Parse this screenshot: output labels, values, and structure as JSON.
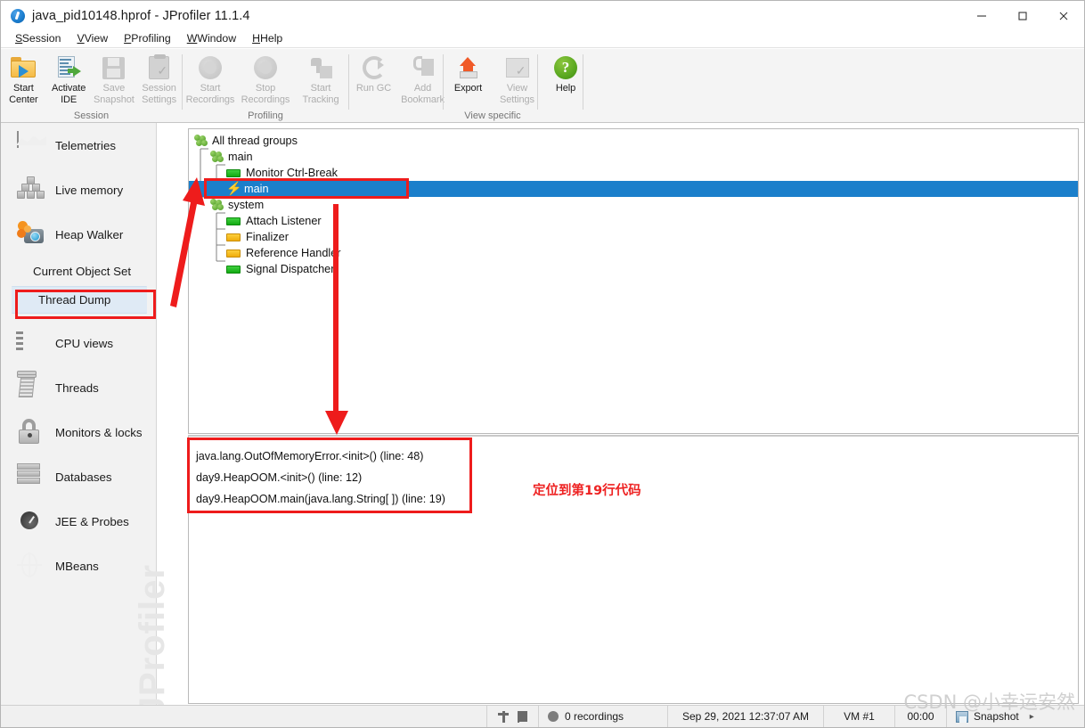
{
  "window": {
    "title": "java_pid10148.hprof - JProfiler 11.1.4",
    "icon": "jprofiler-logo-icon",
    "minimize": "—",
    "maximize": "□",
    "close": "✕"
  },
  "menubar": [
    {
      "label": "Session",
      "mnemonic": "S"
    },
    {
      "label": "View",
      "mnemonic": "V"
    },
    {
      "label": "Profiling",
      "mnemonic": "P"
    },
    {
      "label": "Window",
      "mnemonic": "W"
    },
    {
      "label": "Help",
      "mnemonic": "H"
    }
  ],
  "toolbar": {
    "groups": [
      {
        "name": "Session",
        "buttons": [
          {
            "label": "Start\nCenter",
            "icon": "folder-play-icon",
            "enabled": true
          },
          {
            "label": "Activate\nIDE",
            "icon": "ide-arrow-icon",
            "enabled": true
          },
          {
            "label": "Save\nSnapshot",
            "icon": "floppy-disk-icon",
            "enabled": false
          },
          {
            "label": "Session\nSettings",
            "icon": "clipboard-check-icon",
            "enabled": false
          }
        ]
      },
      {
        "name": "Profiling",
        "buttons": [
          {
            "label": "Start\nRecordings",
            "icon": "record-start-icon",
            "enabled": false
          },
          {
            "label": "Stop\nRecordings",
            "icon": "record-stop-icon",
            "enabled": false
          },
          {
            "label": "Start\nTracking",
            "icon": "tracking-icon",
            "enabled": false
          }
        ]
      },
      {
        "name": "",
        "buttons": [
          {
            "label": "Run GC",
            "icon": "recycle-icon",
            "enabled": false
          },
          {
            "label": "Add\nBookmark",
            "icon": "bookmark-icon",
            "enabled": false
          }
        ]
      },
      {
        "name": "View specific",
        "buttons": [
          {
            "label": "Export",
            "icon": "export-up-arrow-icon",
            "enabled": true
          },
          {
            "label": "View\nSettings",
            "icon": "view-settings-icon",
            "enabled": false
          }
        ]
      },
      {
        "name": "",
        "buttons": [
          {
            "label": "Help",
            "icon": "help-question-icon",
            "enabled": true
          }
        ]
      }
    ]
  },
  "sidebar": {
    "items": [
      {
        "label": "Telemetries",
        "icon": "telemetries-chart-icon",
        "type": "item"
      },
      {
        "label": "Live memory",
        "icon": "live-memory-blocks-icon",
        "type": "item"
      },
      {
        "label": "Heap Walker",
        "icon": "heap-walker-camera-icon",
        "type": "item"
      },
      {
        "label": "Current Object Set",
        "icon": "",
        "type": "sub"
      },
      {
        "label": "Thread Dump",
        "icon": "",
        "type": "selected"
      },
      {
        "label": "CPU views",
        "icon": "cpu-chip-icon",
        "type": "item"
      },
      {
        "label": "Threads",
        "icon": "threads-spool-icon",
        "type": "item"
      },
      {
        "label": "Monitors & locks",
        "icon": "padlock-icon",
        "type": "item"
      },
      {
        "label": "Databases",
        "icon": "database-stack-icon",
        "type": "item"
      },
      {
        "label": "JEE & Probes",
        "icon": "gauge-icon",
        "type": "item"
      },
      {
        "label": "MBeans",
        "icon": "globe-icon",
        "type": "item"
      }
    ],
    "watermark": "JProfiler"
  },
  "thread_tree": [
    {
      "label": "All thread groups",
      "depth": 0,
      "icon": "thread-group-icon",
      "selected": false
    },
    {
      "label": "main",
      "depth": 1,
      "icon": "thread-group-icon",
      "selected": false
    },
    {
      "label": "Monitor Ctrl-Break",
      "depth": 2,
      "icon": "thread-state-green-icon",
      "selected": false
    },
    {
      "label": "main",
      "depth": 2,
      "icon": "thread-bolt-icon",
      "selected": true
    },
    {
      "label": "system",
      "depth": 1,
      "icon": "thread-group-icon",
      "selected": false
    },
    {
      "label": "Attach Listener",
      "depth": 2,
      "icon": "thread-state-green-icon",
      "selected": false
    },
    {
      "label": "Finalizer",
      "depth": 2,
      "icon": "thread-state-orange-icon",
      "selected": false
    },
    {
      "label": "Reference Handler",
      "depth": 2,
      "icon": "thread-state-orange-icon",
      "selected": false
    },
    {
      "label": "Signal Dispatcher",
      "depth": 2,
      "icon": "thread-state-green-icon",
      "selected": false
    }
  ],
  "stack_trace": [
    "java.lang.OutOfMemoryError.<init>() (line: 48)",
    "day9.HeapOOM.<init>() (line: 12)",
    "day9.HeapOOM.main(java.lang.String[ ]) (line: 19)"
  ],
  "annotations": {
    "note": "定位到第19行代码",
    "color": "#ee1c1c"
  },
  "statusbar": {
    "recordings": "0 recordings",
    "timestamp": "Sep 29, 2021 12:37:07 AM",
    "vm": "VM #1",
    "duration": "00:00",
    "snapshot": "Snapshot",
    "pin_icon": "pin-icon",
    "flag_icon": "flag-icon",
    "record_icon": "record-dot-icon",
    "snapshot_icon": "snapshot-icon",
    "overflow_icon": "chevron-right-icon"
  },
  "watermark": "CSDN @小幸运安然"
}
